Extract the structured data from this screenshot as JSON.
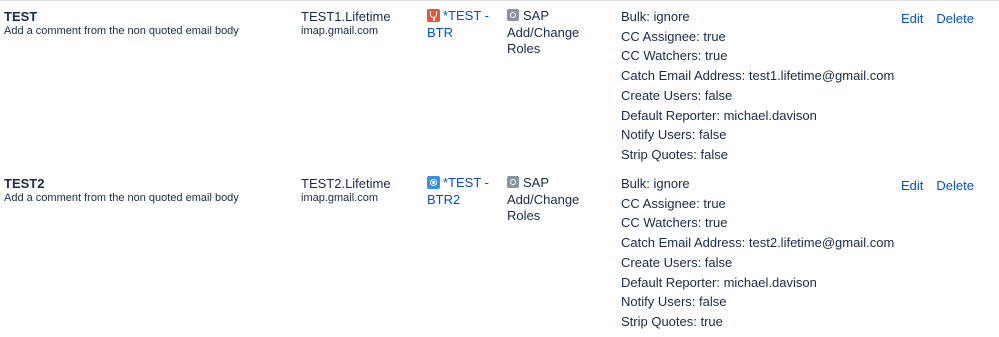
{
  "colors": {
    "text": "#172b4d",
    "link": "#0052cc",
    "divider": "#dfe1e6",
    "issuetype_icon": "#8993a4",
    "project_icon_red": "#e6553a",
    "project_icon_blue": "#3b8fe3"
  },
  "handlers": [
    {
      "name": "TEST",
      "description": "Add a comment from the non quoted email body",
      "server_name": "TEST1.Lifetime",
      "server_host": "imap.gmail.com",
      "project_icon": "project-avatar-icon",
      "project_line1": "*TEST -",
      "project_line2": "BTR",
      "issuetype_icon": "issue-type-icon",
      "issuetype_line1": "SAP Add/Change",
      "issuetype_line2": "Roles",
      "params": [
        "Bulk: ignore",
        "CC Assignee: true",
        "CC Watchers: true",
        "Catch Email Address: test1.lifetime@gmail.com",
        "Create Users: false",
        "Default Reporter: michael.davison",
        "Notify Users: false",
        "Strip Quotes: false"
      ],
      "edit_label": "Edit",
      "delete_label": "Delete"
    },
    {
      "name": "TEST2",
      "description": "Add a comment from the non quoted email body",
      "server_name": "TEST2.Lifetime",
      "server_host": "imap.gmail.com",
      "project_icon": "project-avatar-icon",
      "project_line1": "*TEST -",
      "project_line2": "BTR2",
      "issuetype_icon": "issue-type-icon",
      "issuetype_line1": "SAP Add/Change",
      "issuetype_line2": "Roles",
      "params": [
        "Bulk: ignore",
        "CC Assignee: true",
        "CC Watchers: true",
        "Catch Email Address: test2.lifetime@gmail.com",
        "Create Users: false",
        "Default Reporter: michael.davison",
        "Notify Users: false",
        "Strip Quotes: true"
      ],
      "edit_label": "Edit",
      "delete_label": "Delete"
    }
  ]
}
